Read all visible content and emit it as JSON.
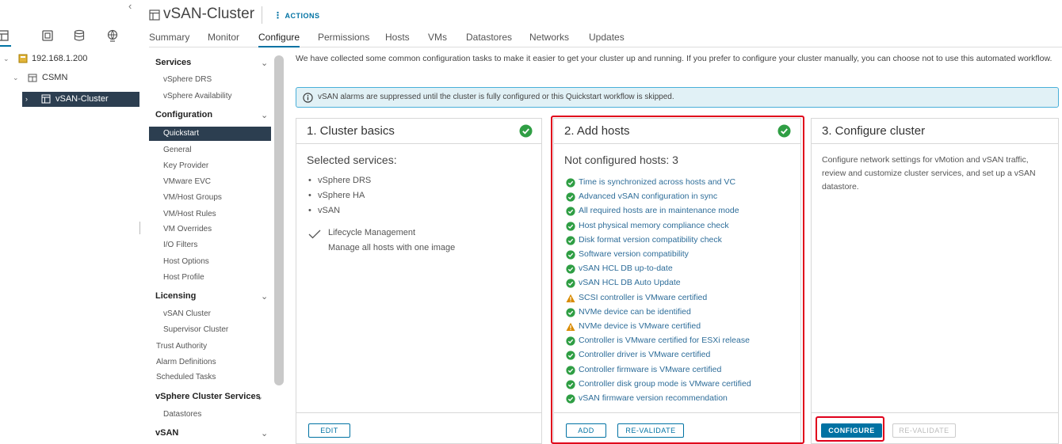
{
  "inventory": {
    "tree": [
      {
        "label": "192.168.1.200"
      },
      {
        "label": "CSMN"
      },
      {
        "label": "vSAN-Cluster"
      }
    ]
  },
  "header": {
    "title": "vSAN-Cluster",
    "actions_label": "ACTIONS"
  },
  "tabs": [
    {
      "label": "Summary"
    },
    {
      "label": "Monitor"
    },
    {
      "label": "Configure"
    },
    {
      "label": "Permissions"
    },
    {
      "label": "Hosts"
    },
    {
      "label": "VMs"
    },
    {
      "label": "Datastores"
    },
    {
      "label": "Networks"
    },
    {
      "label": "Updates"
    }
  ],
  "config_menu": {
    "services": "Services",
    "vsphere_drs": "vSphere DRS",
    "vsphere_availability": "vSphere Availability",
    "configuration": "Configuration",
    "quickstart": "Quickstart",
    "general": "General",
    "key_provider": "Key Provider",
    "vmware_evc": "VMware EVC",
    "vm_host_groups": "VM/Host Groups",
    "vm_host_rules": "VM/Host Rules",
    "vm_overrides": "VM Overrides",
    "io_filters": "I/O Filters",
    "host_options": "Host Options",
    "host_profile": "Host Profile",
    "licensing": "Licensing",
    "vsan_cluster": "vSAN Cluster",
    "supervisor_cluster": "Supervisor Cluster",
    "trust_authority": "Trust Authority",
    "alarm_definitions": "Alarm Definitions",
    "scheduled_tasks": "Scheduled Tasks",
    "vsphere_cluster_services": "vSphere Cluster Services",
    "datastores": "Datastores",
    "vsan": "vSAN"
  },
  "main": {
    "intro": "We have collected some common configuration tasks to make it easier to get your cluster up and running. If you prefer to configure your cluster manually, you can choose not to use this automated workflow.",
    "alert": "vSAN alarms are suppressed until the cluster is fully configured or this Quickstart workflow is skipped."
  },
  "cards": {
    "basics": {
      "title": "1. Cluster basics",
      "subtitle": "Selected services:",
      "services": [
        "vSphere DRS",
        "vSphere HA",
        "vSAN"
      ],
      "lifecycle_title": "Lifecycle Management",
      "lifecycle_desc": "Manage all hosts with one image",
      "edit_label": "EDIT"
    },
    "hosts": {
      "title": "2. Add hosts",
      "subtitle": "Not configured hosts: 3",
      "checks": [
        {
          "label": "Time is synchronized across hosts and VC",
          "status": "ok"
        },
        {
          "label": "Advanced vSAN configuration in sync",
          "status": "ok"
        },
        {
          "label": "All required hosts are in maintenance mode",
          "status": "ok"
        },
        {
          "label": "Host physical memory compliance check",
          "status": "ok"
        },
        {
          "label": "Disk format version compatibility check",
          "status": "ok"
        },
        {
          "label": "Software version compatibility",
          "status": "ok"
        },
        {
          "label": "vSAN HCL DB up-to-date",
          "status": "ok"
        },
        {
          "label": "vSAN HCL DB Auto Update",
          "status": "ok"
        },
        {
          "label": "SCSI controller is VMware certified",
          "status": "warning"
        },
        {
          "label": "NVMe device can be identified",
          "status": "ok"
        },
        {
          "label": "NVMe device is VMware certified",
          "status": "warning"
        },
        {
          "label": "Controller is VMware certified for ESXi release",
          "status": "ok"
        },
        {
          "label": "Controller driver is VMware certified",
          "status": "ok"
        },
        {
          "label": "Controller firmware is VMware certified",
          "status": "ok"
        },
        {
          "label": "Controller disk group mode is VMware certified",
          "status": "ok"
        },
        {
          "label": "vSAN firmware version recommendation",
          "status": "ok"
        }
      ],
      "add_label": "ADD",
      "revalidate_label": "RE-VALIDATE"
    },
    "configure": {
      "title": "3. Configure cluster",
      "description": "Configure network settings for vMotion and vSAN traffic, review and customize cluster services, and set up a vSAN datastore.",
      "configure_label": "CONFIGURE",
      "revalidate_label": "RE-VALIDATE"
    }
  },
  "colors": {
    "accent": "#0072a3",
    "ok": "#2f9e44",
    "warning": "#d98b00",
    "highlight": "#e0001b",
    "nav_selected": "#2c3e50"
  }
}
